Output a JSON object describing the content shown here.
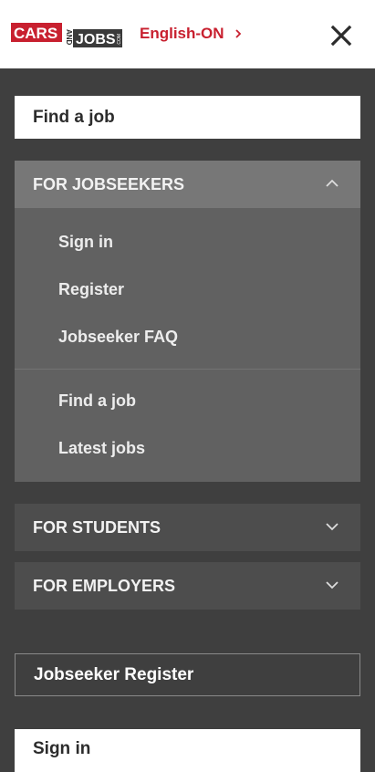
{
  "header": {
    "logo": {
      "top": "CARS",
      "mid": "AND",
      "bottom": "JOBS",
      "suffix": ".COM"
    },
    "language_label": "English-ON",
    "brand_color": "#c8202f"
  },
  "menu": {
    "find_job_button": "Find a job",
    "jobseekers": {
      "title": "FOR JOBSEEKERS",
      "group1": [
        "Sign in",
        "Register",
        "Jobseeker FAQ"
      ],
      "group2": [
        "Find a job",
        "Latest jobs"
      ]
    },
    "students_title": "FOR STUDENTS",
    "employers_title": "FOR EMPLOYERS",
    "register_button": "Jobseeker Register",
    "sign_in_button": "Sign in"
  }
}
